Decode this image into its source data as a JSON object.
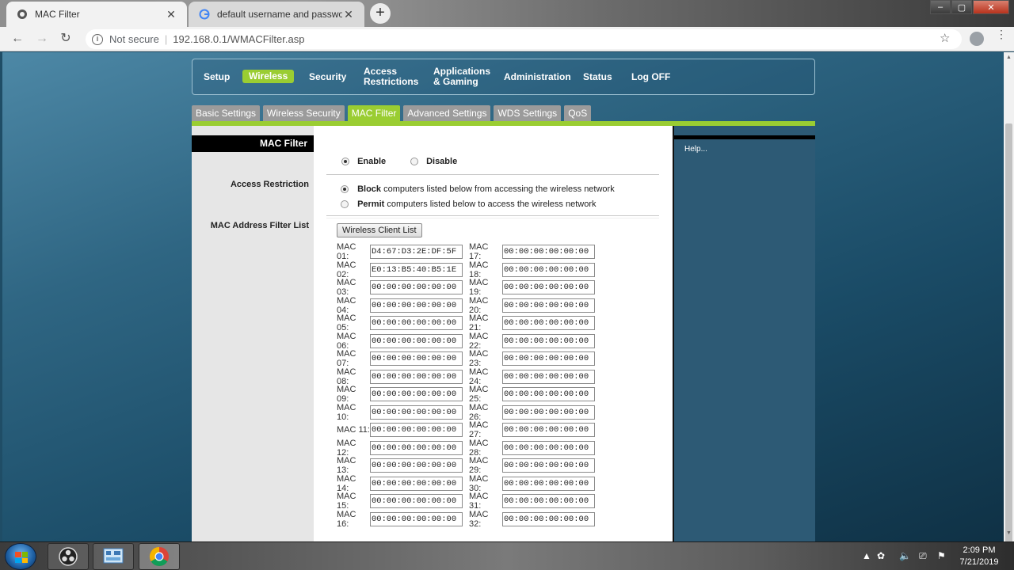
{
  "browser": {
    "tabs": [
      {
        "title": "MAC Filter",
        "close": "✕"
      },
      {
        "title": "default username and password",
        "close": "✕"
      }
    ],
    "new_tab": "+",
    "address": {
      "security": "Not secure",
      "url": "192.168.0.1/WMACFilter.asp"
    }
  },
  "router": {
    "main_nav": [
      "Setup",
      "Wireless",
      "Security",
      "Access\nRestrictions",
      "Applications\n& Gaming",
      "Administration",
      "Status",
      "Log OFF"
    ],
    "active_main": "Wireless",
    "sub_tabs": [
      "Basic Settings",
      "Wireless Security",
      "MAC Filter",
      "Advanced Settings",
      "WDS Settings",
      "QoS"
    ],
    "active_sub": "MAC Filter",
    "section_title": "MAC Filter",
    "labels": {
      "access_restriction": "Access Restriction",
      "mac_list": "MAC Address Filter List"
    },
    "enable": {
      "label": "Enable",
      "selected": true
    },
    "disable": {
      "label": "Disable",
      "selected": false
    },
    "block": {
      "bold": "Block",
      "rest": " computers listed below from accessing the wireless network",
      "selected": true
    },
    "permit": {
      "bold": "Permit",
      "rest": " computers listed below to access the wireless network",
      "selected": false
    },
    "wireless_client_button": "Wireless Client List",
    "help": "Help...",
    "macs": [
      {
        "label": "MAC 01:",
        "value": "D4:67:D3:2E:DF:5F"
      },
      {
        "label": "MAC 02:",
        "value": "E0:13:B5:40:B5:1E"
      },
      {
        "label": "MAC 03:",
        "value": "00:00:00:00:00:00"
      },
      {
        "label": "MAC 04:",
        "value": "00:00:00:00:00:00"
      },
      {
        "label": "MAC 05:",
        "value": "00:00:00:00:00:00"
      },
      {
        "label": "MAC 06:",
        "value": "00:00:00:00:00:00"
      },
      {
        "label": "MAC 07:",
        "value": "00:00:00:00:00:00"
      },
      {
        "label": "MAC 08:",
        "value": "00:00:00:00:00:00"
      },
      {
        "label": "MAC 09:",
        "value": "00:00:00:00:00:00"
      },
      {
        "label": "MAC 10:",
        "value": "00:00:00:00:00:00"
      },
      {
        "label": "MAC 11:",
        "value": "00:00:00:00:00:00"
      },
      {
        "label": "MAC 12:",
        "value": "00:00:00:00:00:00"
      },
      {
        "label": "MAC 13:",
        "value": "00:00:00:00:00:00"
      },
      {
        "label": "MAC 14:",
        "value": "00:00:00:00:00:00"
      },
      {
        "label": "MAC 15:",
        "value": "00:00:00:00:00:00"
      },
      {
        "label": "MAC 16:",
        "value": "00:00:00:00:00:00"
      },
      {
        "label": "MAC 17:",
        "value": "00:00:00:00:00:00"
      },
      {
        "label": "MAC 18:",
        "value": "00:00:00:00:00:00"
      },
      {
        "label": "MAC 19:",
        "value": "00:00:00:00:00:00"
      },
      {
        "label": "MAC 20:",
        "value": "00:00:00:00:00:00"
      },
      {
        "label": "MAC 21:",
        "value": "00:00:00:00:00:00"
      },
      {
        "label": "MAC 22:",
        "value": "00:00:00:00:00:00"
      },
      {
        "label": "MAC 23:",
        "value": "00:00:00:00:00:00"
      },
      {
        "label": "MAC 24:",
        "value": "00:00:00:00:00:00"
      },
      {
        "label": "MAC 25:",
        "value": "00:00:00:00:00:00"
      },
      {
        "label": "MAC 26:",
        "value": "00:00:00:00:00:00"
      },
      {
        "label": "MAC 27:",
        "value": "00:00:00:00:00:00"
      },
      {
        "label": "MAC 28:",
        "value": "00:00:00:00:00:00"
      },
      {
        "label": "MAC 29:",
        "value": "00:00:00:00:00:00"
      },
      {
        "label": "MAC 30:",
        "value": "00:00:00:00:00:00"
      },
      {
        "label": "MAC 31:",
        "value": "00:00:00:00:00:00"
      },
      {
        "label": "MAC 32:",
        "value": "00:00:00:00:00:00"
      }
    ]
  },
  "taskbar": {
    "time": "2:09 PM",
    "date": "7/21/2019",
    "apps": [
      "obs-icon",
      "network-icon",
      "chrome-icon"
    ]
  },
  "colors": {
    "accent_green": "#9acd32",
    "help_bg": "#2d5a75"
  }
}
